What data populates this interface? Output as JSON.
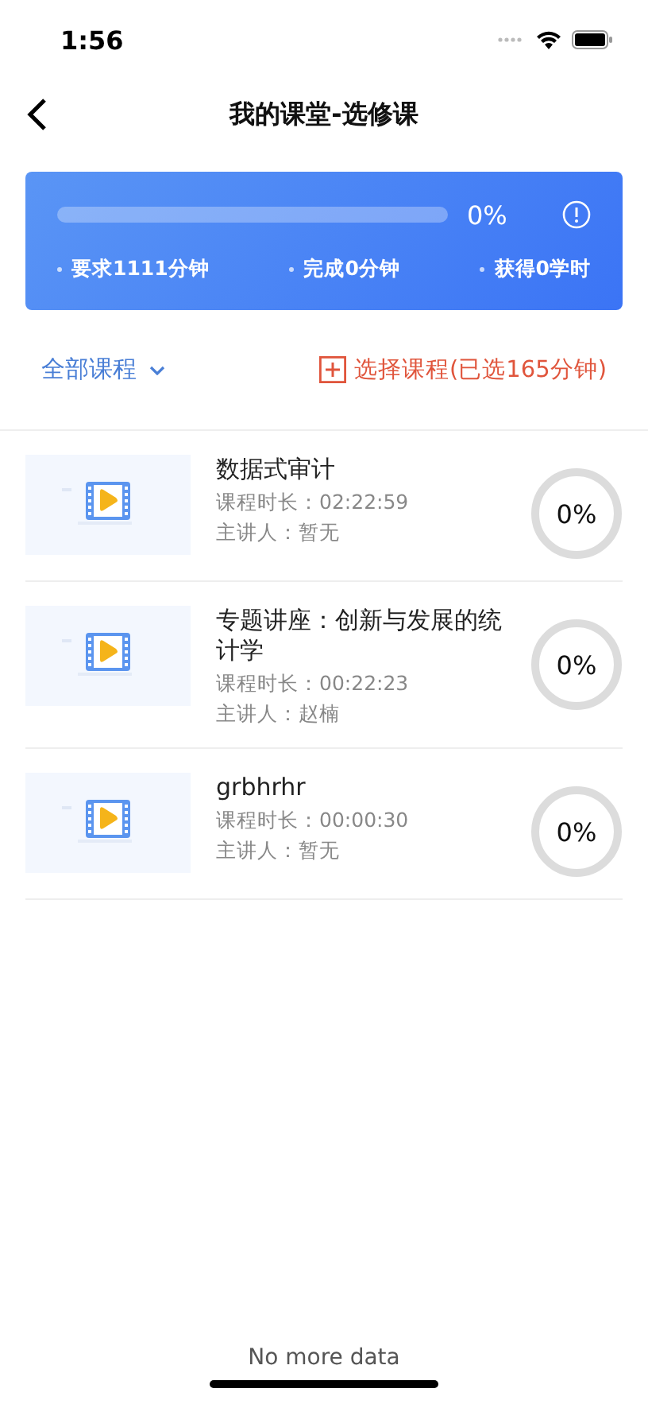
{
  "status_bar": {
    "time": "1:56"
  },
  "nav": {
    "title": "我的课堂-选修课"
  },
  "summary": {
    "level": 0,
    "percent": "0%",
    "stats": [
      "要求1111分钟",
      "完成0分钟",
      "获得0学时"
    ]
  },
  "filter": {
    "label": "全部课程",
    "select_button": "选择课程(已选165分钟)"
  },
  "courses": [
    {
      "title": "数据式审计",
      "duration_label": "课程时长：",
      "duration": "02:22:59",
      "speaker_label": "主讲人：",
      "speaker": "暂无",
      "level": 0,
      "percent": "0%"
    },
    {
      "title": "专题讲座：创新与发展的统计学",
      "duration_label": "课程时长：",
      "duration": "00:22:23",
      "speaker_label": "主讲人：",
      "speaker": "赵楠",
      "level": 0,
      "percent": "0%"
    },
    {
      "title": "grbhrhr",
      "duration_label": "课程时长：",
      "duration": "00:00:30",
      "speaker_label": "主讲人：",
      "speaker": "暂无",
      "level": 0,
      "percent": "0%"
    }
  ],
  "footer": "No more data"
}
